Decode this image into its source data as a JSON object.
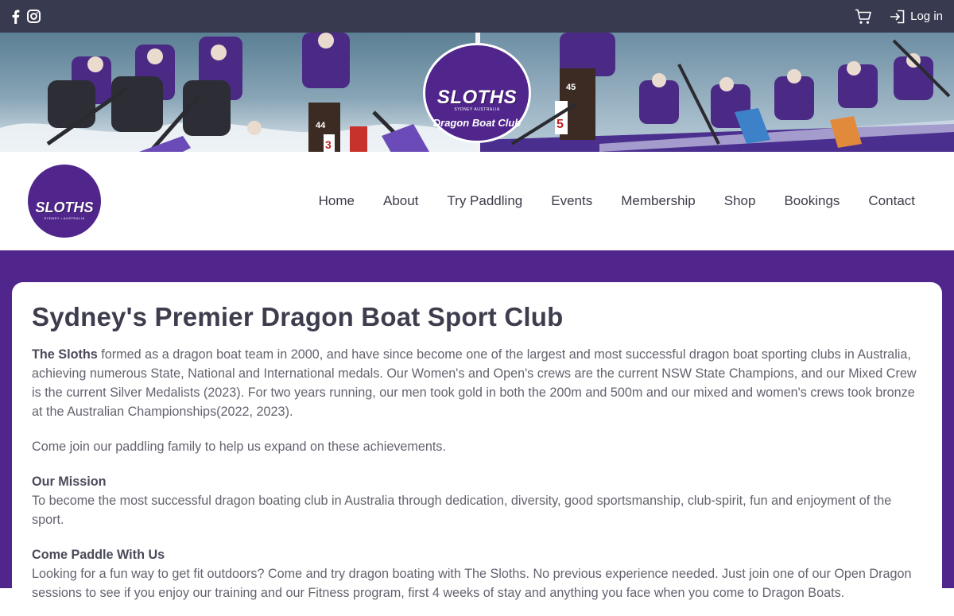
{
  "topbar": {
    "facebook_icon": "facebook-icon",
    "instagram_icon": "instagram-icon",
    "cart_icon": "cart-icon",
    "login_label": "Log in"
  },
  "banner": {
    "logo_name": "SLOTHS",
    "logo_sub": "SYDNEY AUSTRALIA",
    "logo_subtitle": "Dragon Boat Club",
    "boat_numbers": [
      "44",
      "3",
      "45",
      "5"
    ]
  },
  "nav": {
    "logo_name": "SLOTHS",
    "logo_sub": "SYDNEY • AUSTRALIA",
    "items": [
      "Home",
      "About",
      "Try Paddling",
      "Events",
      "Membership",
      "Shop",
      "Bookings",
      "Contact"
    ]
  },
  "content": {
    "title": "Sydney's Premier Dragon Boat Sport Club",
    "intro_bold": "The Sloths",
    "intro_rest": " formed as a dragon boat team in 2000, and have since become one of the largest and most successful dragon boat sporting clubs in Australia, achieving numerous State, National and International medals. Our Women's and Open's crews are the current NSW State Champions, and our Mixed Crew is the current Silver Medalists (2023). For two years running, our men took gold in both the 200m and 500m and our mixed and women's crews took bronze at the Australian Championships(2022, 2023).",
    "join": "Come join our paddling family to help us expand on these achievements.",
    "mission_heading": "Our Mission",
    "mission_text": "To become the most successful dragon boating club in Australia through dedication, diversity, good sportsmanship, club-spirit, fun and enjoyment of the sport.",
    "paddle_heading": "Come Paddle With Us",
    "paddle_text": "Looking for a fun way to get fit outdoors? Come and try dragon boating with The Sloths. No previous experience needed. Just join one of our Open Dragon sessions to see if you enjoy our training and our Fitness program, first 4 weeks of stay and anything you face when you come to Dragon Boats."
  },
  "colors": {
    "topbar": "#383a4f",
    "brand_purple": "#51268c",
    "text": "#63636f",
    "heading": "#3d3d4d"
  }
}
